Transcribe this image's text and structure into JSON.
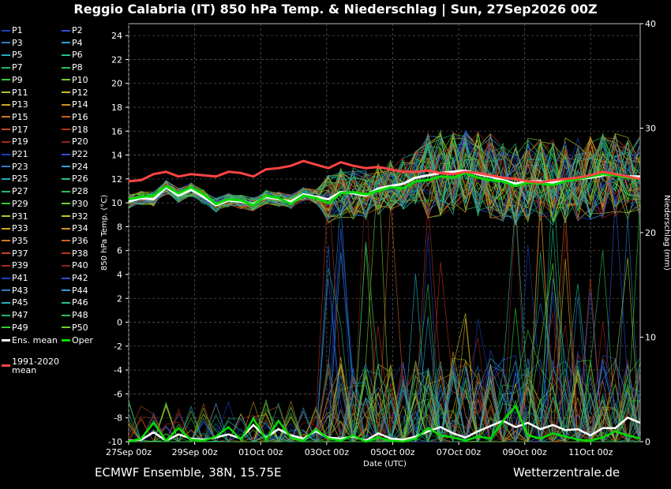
{
  "title": "Reggio Calabria  (IT)  850 hPa Temp. & Niederschlag | Sun, 27Sep2026 00Z",
  "footer_left": "ECMWF Ensemble, 38N, 15.75E",
  "footer_right": "Wetterzentrale.de",
  "colors": {
    "background": "#000000",
    "grid": "#555555",
    "mean": "#ffffff",
    "oper": "#00dd00",
    "clim": "#ff4444"
  },
  "legend": [
    {
      "label": "P1",
      "color": "#1f3fbf"
    },
    {
      "label": "P2",
      "color": "#2f4fd8"
    },
    {
      "label": "P3",
      "color": "#2a7fd0"
    },
    {
      "label": "P4",
      "color": "#2f9fd8"
    },
    {
      "label": "P5",
      "color": "#1fb0c0"
    },
    {
      "label": "P6",
      "color": "#1fc09a"
    },
    {
      "label": "P7",
      "color": "#1fb870"
    },
    {
      "label": "P8",
      "color": "#2fbf50"
    },
    {
      "label": "P9",
      "color": "#2fcf2f"
    },
    {
      "label": "P10",
      "color": "#6fd02f"
    },
    {
      "label": "P11",
      "color": "#a8c828"
    },
    {
      "label": "P12",
      "color": "#c8c020"
    },
    {
      "label": "P13",
      "color": "#d0a820"
    },
    {
      "label": "P14",
      "color": "#d09020"
    },
    {
      "label": "P15",
      "color": "#d07820"
    },
    {
      "label": "P16",
      "color": "#c86020"
    },
    {
      "label": "P17",
      "color": "#c04820"
    },
    {
      "label": "P18",
      "color": "#b83018"
    },
    {
      "label": "P19",
      "color": "#a82818"
    },
    {
      "label": "P20",
      "color": "#902018"
    },
    {
      "label": "P21",
      "color": "#1f3fbf"
    },
    {
      "label": "P22",
      "color": "#2f4fd8"
    },
    {
      "label": "P23",
      "color": "#2a7fd0"
    },
    {
      "label": "P24",
      "color": "#2f9fd8"
    },
    {
      "label": "P25",
      "color": "#1fb0c0"
    },
    {
      "label": "P26",
      "color": "#1fc09a"
    },
    {
      "label": "P27",
      "color": "#1fb870"
    },
    {
      "label": "P28",
      "color": "#2fbf50"
    },
    {
      "label": "P29",
      "color": "#2fcf2f"
    },
    {
      "label": "P30",
      "color": "#6fd02f"
    },
    {
      "label": "P31",
      "color": "#a8c828"
    },
    {
      "label": "P32",
      "color": "#c8c020"
    },
    {
      "label": "P33",
      "color": "#d0a820"
    },
    {
      "label": "P34",
      "color": "#d09020"
    },
    {
      "label": "P35",
      "color": "#d07820"
    },
    {
      "label": "P36",
      "color": "#c86020"
    },
    {
      "label": "P37",
      "color": "#c04820"
    },
    {
      "label": "P38",
      "color": "#b83018"
    },
    {
      "label": "P39",
      "color": "#a82818"
    },
    {
      "label": "P40",
      "color": "#902018"
    },
    {
      "label": "P41",
      "color": "#1f3fbf"
    },
    {
      "label": "P42",
      "color": "#2f4fd8"
    },
    {
      "label": "P43",
      "color": "#2a7fd0"
    },
    {
      "label": "P44",
      "color": "#2f9fd8"
    },
    {
      "label": "P45",
      "color": "#1fb0c0"
    },
    {
      "label": "P46",
      "color": "#1fc09a"
    },
    {
      "label": "P47",
      "color": "#1fb870"
    },
    {
      "label": "P48",
      "color": "#2fbf50"
    },
    {
      "label": "P49",
      "color": "#2fcf2f"
    },
    {
      "label": "P50",
      "color": "#6fd02f"
    },
    {
      "label": "Ens. mean",
      "color": "#ffffff",
      "thick": true
    },
    {
      "label": "Oper",
      "color": "#00dd00",
      "thick": true
    },
    {
      "label": "1991-2020 mean",
      "color": "#ff4444",
      "thick": true
    }
  ],
  "chart_data": {
    "type": "line",
    "xlabel": "Date (UTC)",
    "ylabel": "850 hPa Temp. (°C)",
    "ylabel_right": "Niederschlag (mm)",
    "ylim": [
      -10,
      25
    ],
    "ylim_right": [
      0,
      40
    ],
    "xlim": [
      "27Sep 00z",
      "12Oct 12z"
    ],
    "x_tick_labels": [
      "27Sep 00z",
      "29Sep 00z",
      "01Oct 00z",
      "03Oct 00z",
      "05Oct 00z",
      "07Oct 00z",
      "09Oct 00z",
      "11Oct 00z"
    ],
    "y_ticks": [
      -10,
      -8,
      -6,
      -4,
      -2,
      0,
      2,
      4,
      6,
      8,
      10,
      12,
      14,
      16,
      18,
      20,
      22,
      24
    ],
    "y_ticks_right": [
      0,
      10,
      20,
      30,
      40
    ],
    "grid": true,
    "temperature_series": [
      {
        "name": "Ens. mean",
        "values": [
          10.1,
          10.4,
          10.3,
          11.3,
          10.6,
          11.1,
          10.5,
          9.8,
          10.2,
          10.1,
          9.9,
          10.5,
          10.3,
          10.1,
          10.7,
          10.5,
          10.3,
          10.9,
          10.8,
          10.6,
          11.2,
          11.4,
          11.6,
          12.1,
          12.3,
          12.5,
          12.6,
          12.7,
          12.4,
          12.2,
          11.9,
          11.6,
          11.8,
          11.8,
          11.7,
          11.9,
          12.0,
          12.1,
          12.3,
          12.4,
          12.2,
          12.2
        ]
      },
      {
        "name": "Oper",
        "values": [
          10.3,
          10.5,
          10.6,
          11.4,
          10.8,
          11.3,
          10.7,
          9.9,
          10.3,
          10.2,
          9.8,
          10.6,
          10.4,
          9.9,
          10.6,
          10.4,
          10.0,
          10.8,
          10.9,
          10.7,
          11.0,
          11.3,
          11.2,
          11.8,
          11.9,
          12.2,
          12.1,
          12.5,
          12.1,
          11.9,
          11.8,
          11.4,
          11.7,
          11.6,
          11.5,
          11.8,
          12.0,
          12.2,
          12.4,
          12.3,
          12.1,
          12.0
        ]
      },
      {
        "name": "1991-2020 mean",
        "values": [
          11.8,
          11.9,
          12.4,
          12.6,
          12.2,
          12.4,
          12.3,
          12.2,
          12.6,
          12.5,
          12.2,
          12.8,
          12.9,
          13.1,
          13.5,
          13.2,
          12.9,
          13.4,
          13.1,
          12.9,
          13.0,
          12.8,
          12.6,
          12.6,
          12.7,
          12.5,
          12.4,
          12.6,
          12.5,
          12.3,
          12.1,
          12.0,
          11.8,
          11.7,
          11.9,
          12.0,
          12.1,
          12.3,
          12.6,
          12.4,
          12.2,
          12.0
        ]
      }
    ],
    "precipitation_series": [
      {
        "name": "Ens. mean",
        "values": [
          0.1,
          0.2,
          0.9,
          0.1,
          0.7,
          0.3,
          0.2,
          0.4,
          0.7,
          0.3,
          1.6,
          0.4,
          1.2,
          0.6,
          0.3,
          1.0,
          0.4,
          0.3,
          0.5,
          0.1,
          0.8,
          0.3,
          0.2,
          0.5,
          1.0,
          1.4,
          0.8,
          0.4,
          1.0,
          1.5,
          2.0,
          1.4,
          1.8,
          1.2,
          1.6,
          1.1,
          1.2,
          0.6,
          1.3,
          1.3,
          2.3,
          1.8
        ]
      },
      {
        "name": "Oper",
        "values": [
          0.0,
          0.3,
          1.8,
          0.1,
          1.3,
          0.2,
          0.1,
          0.5,
          1.4,
          0.2,
          2.2,
          0.2,
          2.0,
          0.4,
          0.1,
          1.2,
          0.3,
          0.1,
          0.6,
          0.0,
          0.4,
          0.1,
          0.0,
          0.3,
          1.3,
          0.6,
          0.4,
          0.1,
          0.5,
          0.3,
          2.0,
          3.4,
          0.6,
          0.3,
          0.8,
          0.5,
          0.2,
          0.1,
          0.4,
          1.0,
          0.6,
          0.3
        ]
      }
    ]
  }
}
